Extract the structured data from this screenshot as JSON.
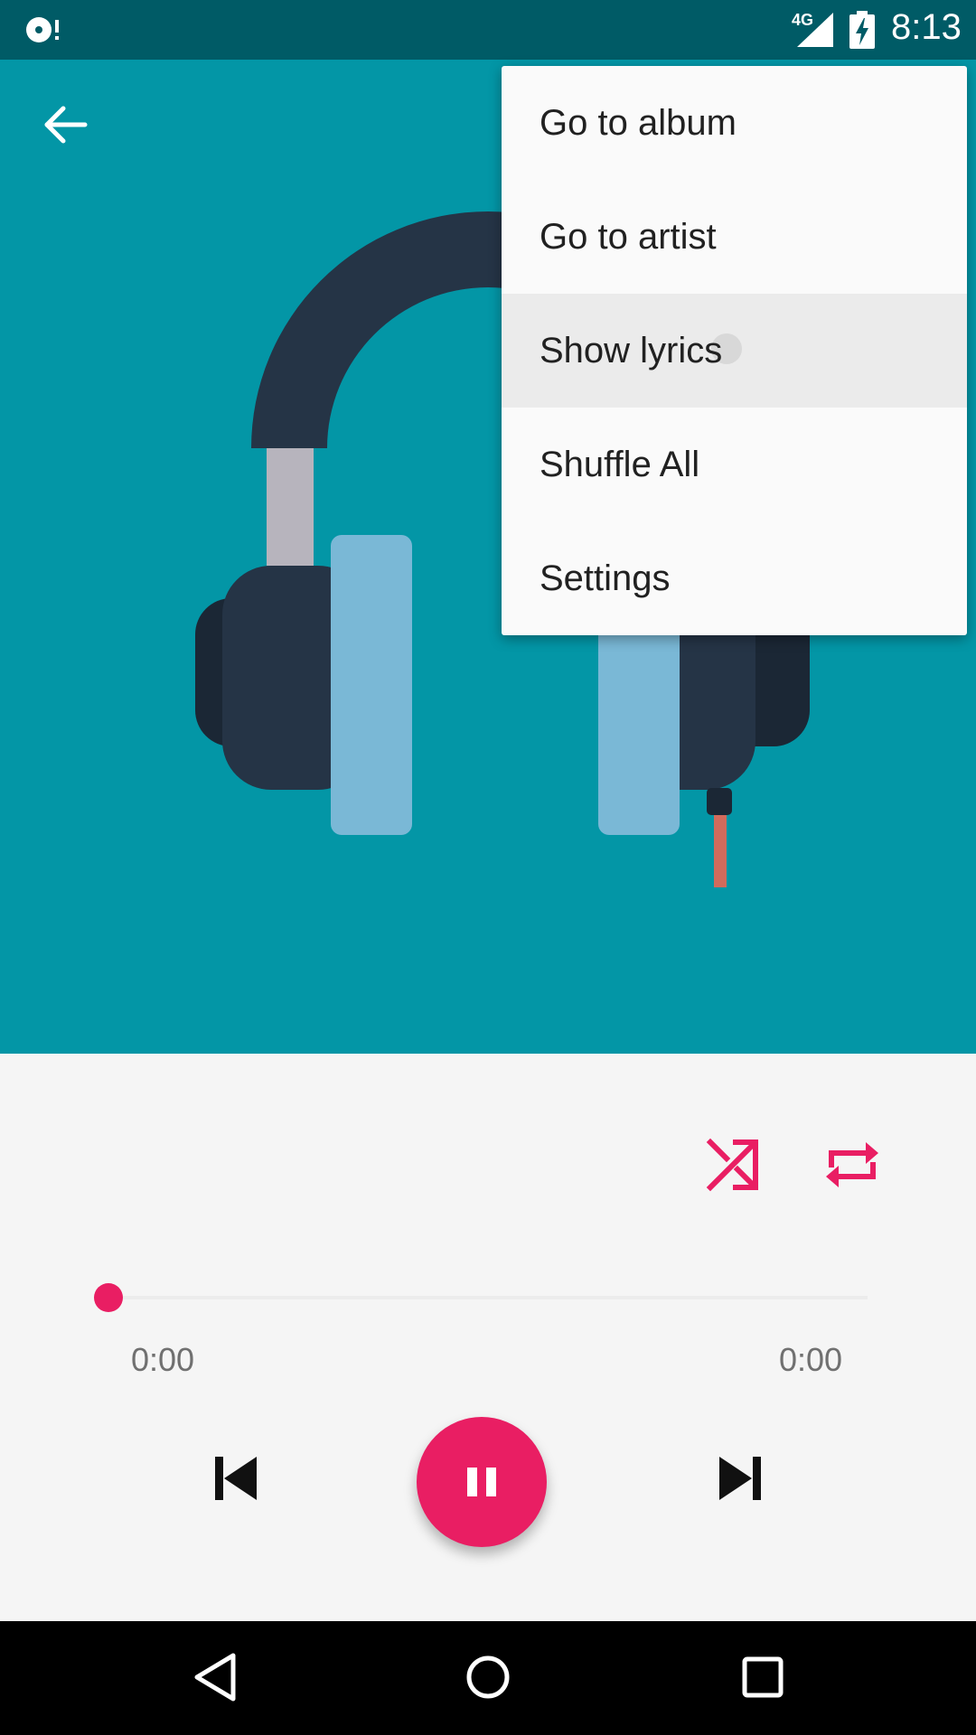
{
  "status_bar": {
    "app_icon": "music-disc-icon",
    "network": "4G",
    "signal_icon": "cell-signal-icon",
    "battery_icon": "battery-charging-icon",
    "time": "8:13"
  },
  "header": {
    "back_icon": "arrow-back-icon"
  },
  "album_art": {
    "icon": "headphones-illustration",
    "background_color": "#0396a6"
  },
  "overflow_menu": {
    "items": [
      {
        "label": "Go to album"
      },
      {
        "label": "Go to artist"
      },
      {
        "label": "Show lyrics",
        "pressed": true
      },
      {
        "label": "Shuffle All"
      },
      {
        "label": "Settings"
      }
    ]
  },
  "player": {
    "accent_color": "#e91e63",
    "shuffle_icon": "shuffle-icon",
    "repeat_icon": "repeat-icon",
    "progress": 0,
    "time_elapsed": "0:00",
    "time_total": "0:00",
    "prev_icon": "skip-previous-icon",
    "play_pause_icon": "pause-icon",
    "next_icon": "skip-next-icon"
  },
  "nav_bar": {
    "back_icon": "nav-back-icon",
    "home_icon": "nav-home-icon",
    "recents_icon": "nav-recents-icon"
  }
}
